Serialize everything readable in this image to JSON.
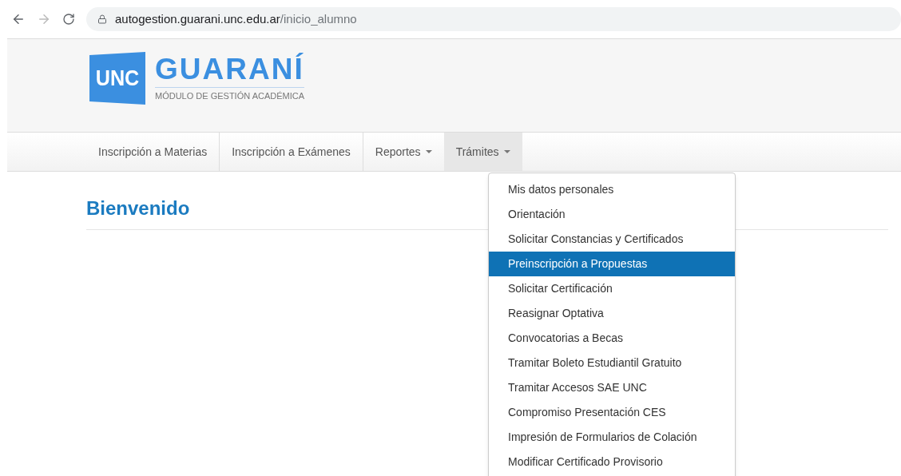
{
  "browser": {
    "url_host": "autogestion.guarani.unc.edu.ar",
    "url_path": "/inicio_alumno",
    "forward_disabled": true
  },
  "logo": {
    "badge": "UNC",
    "title": "GUARANÍ",
    "subtitle": "MÓDULO DE GESTIÓN ACADÉMICA"
  },
  "nav": [
    {
      "label": "Inscripción a Materias",
      "kind": "link",
      "open": false
    },
    {
      "label": "Inscripción a Exámenes",
      "kind": "link",
      "open": false
    },
    {
      "label": "Reportes",
      "kind": "dropdown",
      "open": false
    },
    {
      "label": "Trámites",
      "kind": "dropdown",
      "open": true
    }
  ],
  "heading": "Bienvenido",
  "menu": [
    {
      "label": "Mis datos personales",
      "selected": false
    },
    {
      "label": "Orientación",
      "selected": false
    },
    {
      "label": "Solicitar Constancias y Certificados",
      "selected": false
    },
    {
      "label": "Preinscripción a Propuestas",
      "selected": true
    },
    {
      "label": "Solicitar Certificación",
      "selected": false
    },
    {
      "label": "Reasignar Optativa",
      "selected": false
    },
    {
      "label": "Convocatorias a Becas",
      "selected": false
    },
    {
      "label": "Tramitar Boleto Estudiantil Gratuito",
      "selected": false
    },
    {
      "label": "Tramitar Accesos SAE UNC",
      "selected": false
    },
    {
      "label": "Compromiso Presentación CES",
      "selected": false
    },
    {
      "label": "Impresión de Formularios de Colación",
      "selected": false
    },
    {
      "label": "Modificar Certificado Provisorio",
      "selected": false
    }
  ]
}
